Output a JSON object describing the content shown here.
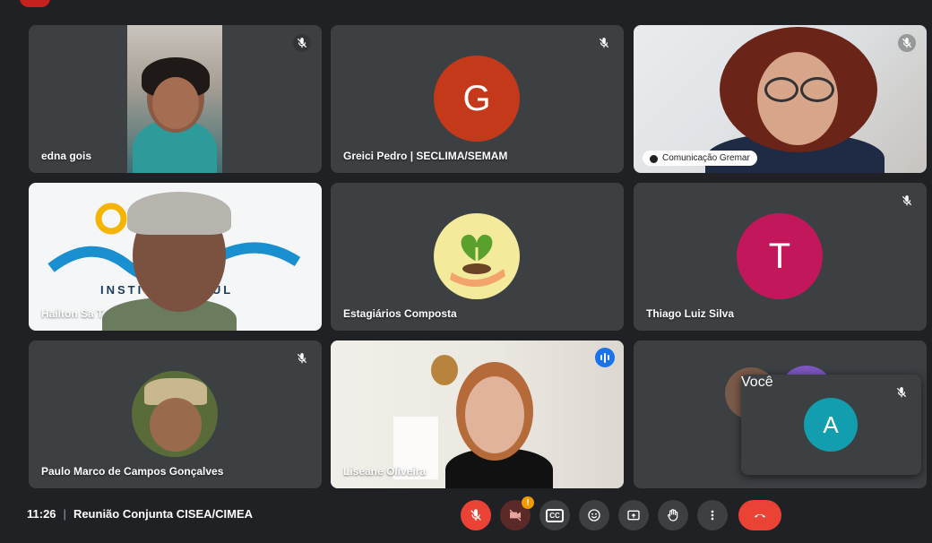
{
  "participants": {
    "edna": {
      "name": "edna gois"
    },
    "greici": {
      "name": "Greici Pedro | SECLIMA/SEMAM",
      "initial": "G",
      "color": "#c5391b"
    },
    "comunicacao": {
      "name": "Comunicação Gremar"
    },
    "hailton": {
      "name": "Hailton Sa T",
      "logo_text": "INSTITUTO    AZUL"
    },
    "estagiarios": {
      "name": "Estagiários Composta"
    },
    "thiago": {
      "name": "Thiago Luiz Silva",
      "initial": "T",
      "color": "#c2185b"
    },
    "paulo": {
      "name": "Paulo Marco de Campos Gonçalves"
    },
    "liseane": {
      "name": "Liseane Oliveira"
    },
    "voce": {
      "name": "Você",
      "initial": "A",
      "color": "#129eaf"
    }
  },
  "meeting": {
    "time": "11:26",
    "title": "Reunião Conjunta CISEA/CIMEA"
  },
  "controls": {
    "warning_badge": "!",
    "captions_label": "CC"
  },
  "colors": {
    "background": "#202124",
    "tile": "#3c4043",
    "accent": "#1a73e8",
    "danger": "#ea4335"
  }
}
